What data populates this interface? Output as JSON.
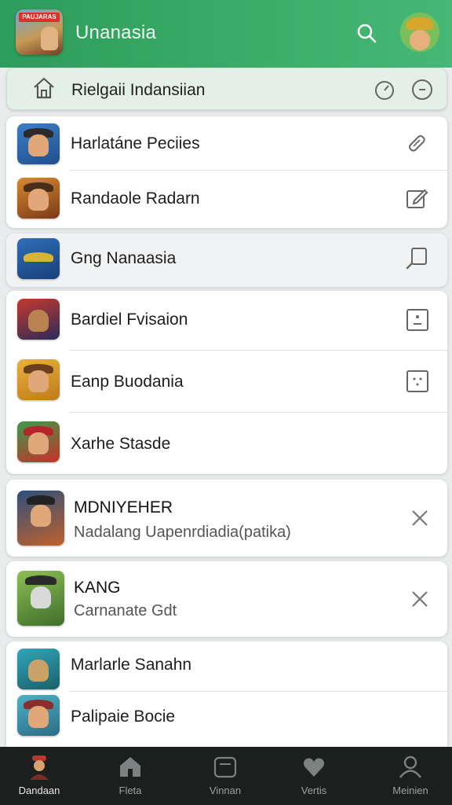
{
  "header": {
    "app_title": "Unanasia",
    "logo_text": "PAUJARAS",
    "search_icon": "search-icon",
    "avatar_icon": "avatar"
  },
  "breadcrumb": {
    "text": "Rielgaii Indansiian",
    "icons": [
      "home-icon",
      "refresh-icon",
      "timer-icon"
    ]
  },
  "groups": [
    {
      "items": [
        {
          "label": "Harlatáne Peciies",
          "icon": "edit-pen-icon"
        },
        {
          "label": "Randaole Radarn",
          "icon": "edit-box-icon"
        }
      ]
    },
    {
      "items": [
        {
          "label": "Gng Nanaasia",
          "icon": "search-box-icon"
        }
      ]
    },
    {
      "items": [
        {
          "label": "Bardiel Fvisaion",
          "icon": "contact-card-icon"
        },
        {
          "label": "Eanp Buodania",
          "icon": "badge-icon"
        },
        {
          "label": "Xarhe Stasde",
          "icon": ""
        }
      ]
    }
  ],
  "notifications": [
    {
      "title": "MDNIYEHER",
      "subtitle": "Nadalang Uapenrdiadia(patika)",
      "close_icon": "close-icon"
    },
    {
      "title": "KANG",
      "subtitle": "Carnanate Gdt",
      "close_icon": "close-icon"
    }
  ],
  "bottom_list": [
    {
      "label": "Marlarle Sanahn"
    },
    {
      "label": "Palipaie Bocie"
    }
  ],
  "nav": [
    {
      "label": "Dandaan",
      "icon": "profile-avatar-icon",
      "active": true
    },
    {
      "label": "Fleta",
      "icon": "home-icon",
      "active": false
    },
    {
      "label": "Vinnan",
      "icon": "gamepad-icon",
      "active": false
    },
    {
      "label": "Vertis",
      "icon": "heart-icon",
      "active": false
    },
    {
      "label": "Meinien",
      "icon": "person-icon",
      "active": false
    }
  ],
  "colors": {
    "header_green": "#3cae6a",
    "nav_bg": "#1d1f1f",
    "background": "#e9ecec"
  }
}
